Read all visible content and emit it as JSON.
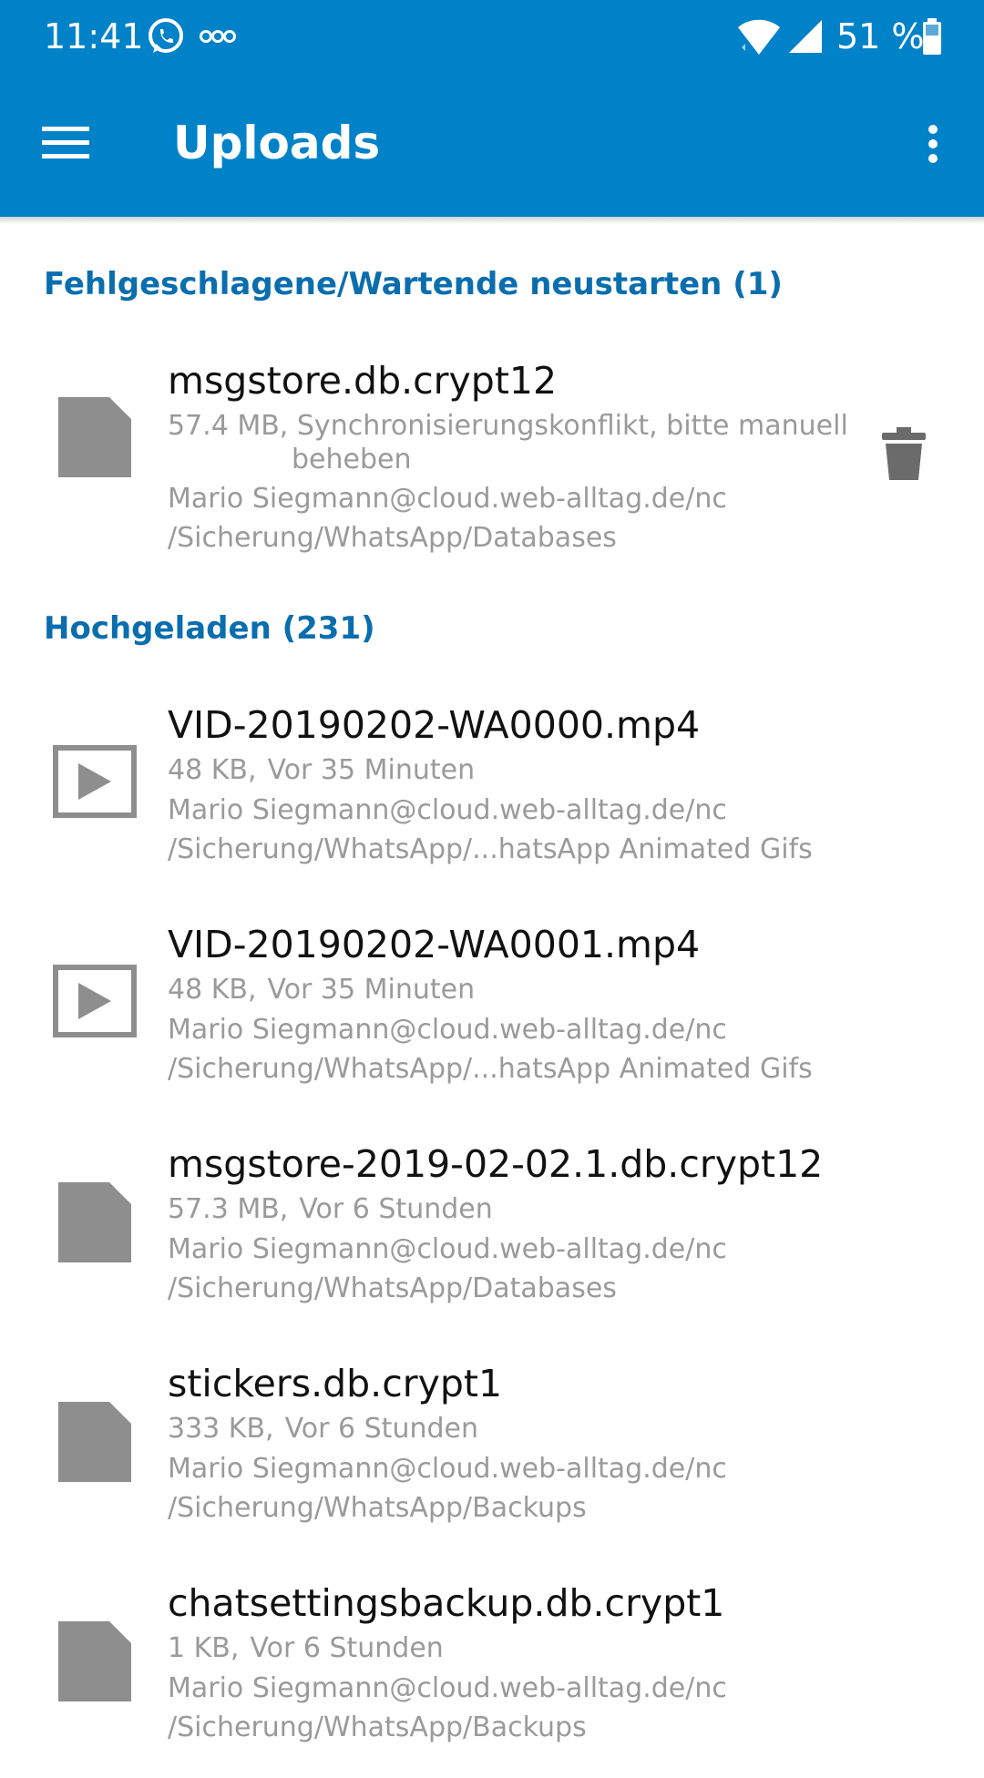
{
  "status_bar": {
    "time": "11:41",
    "battery_percent": "51 %",
    "icons": [
      "whatsapp-icon",
      "voicemail-icon",
      "wifi-icon",
      "signal-icon",
      "battery-icon"
    ]
  },
  "toolbar": {
    "title": "Uploads",
    "menu_icon": "hamburger-menu-icon",
    "overflow_icon": "overflow-menu-icon"
  },
  "colors": {
    "primary": "#0082c9",
    "section_header": "#0a6eae",
    "secondary_text": "#9a9a9a",
    "file_icon": "#8e8e8e"
  },
  "sections": [
    {
      "header": "Fehlgeschlagene/Wartende neustarten (1)",
      "items": [
        {
          "name": "msgstore.db.crypt12",
          "icon": "file-icon",
          "size": "57.4 MB,",
          "status_line1": "Synchronisierungskonflikt, bitte manuell",
          "status_line2": "beheben",
          "account": "Mario Siegmann@cloud.web-alltag.de/nc",
          "path": "/Sicherung/WhatsApp/Databases",
          "action_icon": "trash-icon"
        }
      ]
    },
    {
      "header": "Hochgeladen (231)",
      "items": [
        {
          "name": "VID-20190202-WA0000.mp4",
          "icon": "video-file-icon",
          "size": "48 KB,",
          "time": "Vor 35 Minuten",
          "account": "Mario Siegmann@cloud.web-alltag.de/nc",
          "path": "/Sicherung/WhatsApp/...hatsApp Animated Gifs"
        },
        {
          "name": "VID-20190202-WA0001.mp4",
          "icon": "video-file-icon",
          "size": "48 KB,",
          "time": "Vor 35 Minuten",
          "account": "Mario Siegmann@cloud.web-alltag.de/nc",
          "path": "/Sicherung/WhatsApp/...hatsApp Animated Gifs"
        },
        {
          "name": "msgstore-2019-02-02.1.db.crypt12",
          "icon": "file-icon",
          "size": "57.3 MB,",
          "time": "Vor 6 Stunden",
          "account": "Mario Siegmann@cloud.web-alltag.de/nc",
          "path": "/Sicherung/WhatsApp/Databases"
        },
        {
          "name": "stickers.db.crypt1",
          "icon": "file-icon",
          "size": "333 KB,",
          "time": "Vor 6 Stunden",
          "account": "Mario Siegmann@cloud.web-alltag.de/nc",
          "path": "/Sicherung/WhatsApp/Backups"
        },
        {
          "name": "chatsettingsbackup.db.crypt1",
          "icon": "file-icon",
          "size": "1 KB,",
          "time": "Vor 6 Stunden",
          "account": "Mario Siegmann@cloud.web-alltag.de/nc",
          "path": "/Sicherung/WhatsApp/Backups"
        }
      ]
    }
  ]
}
